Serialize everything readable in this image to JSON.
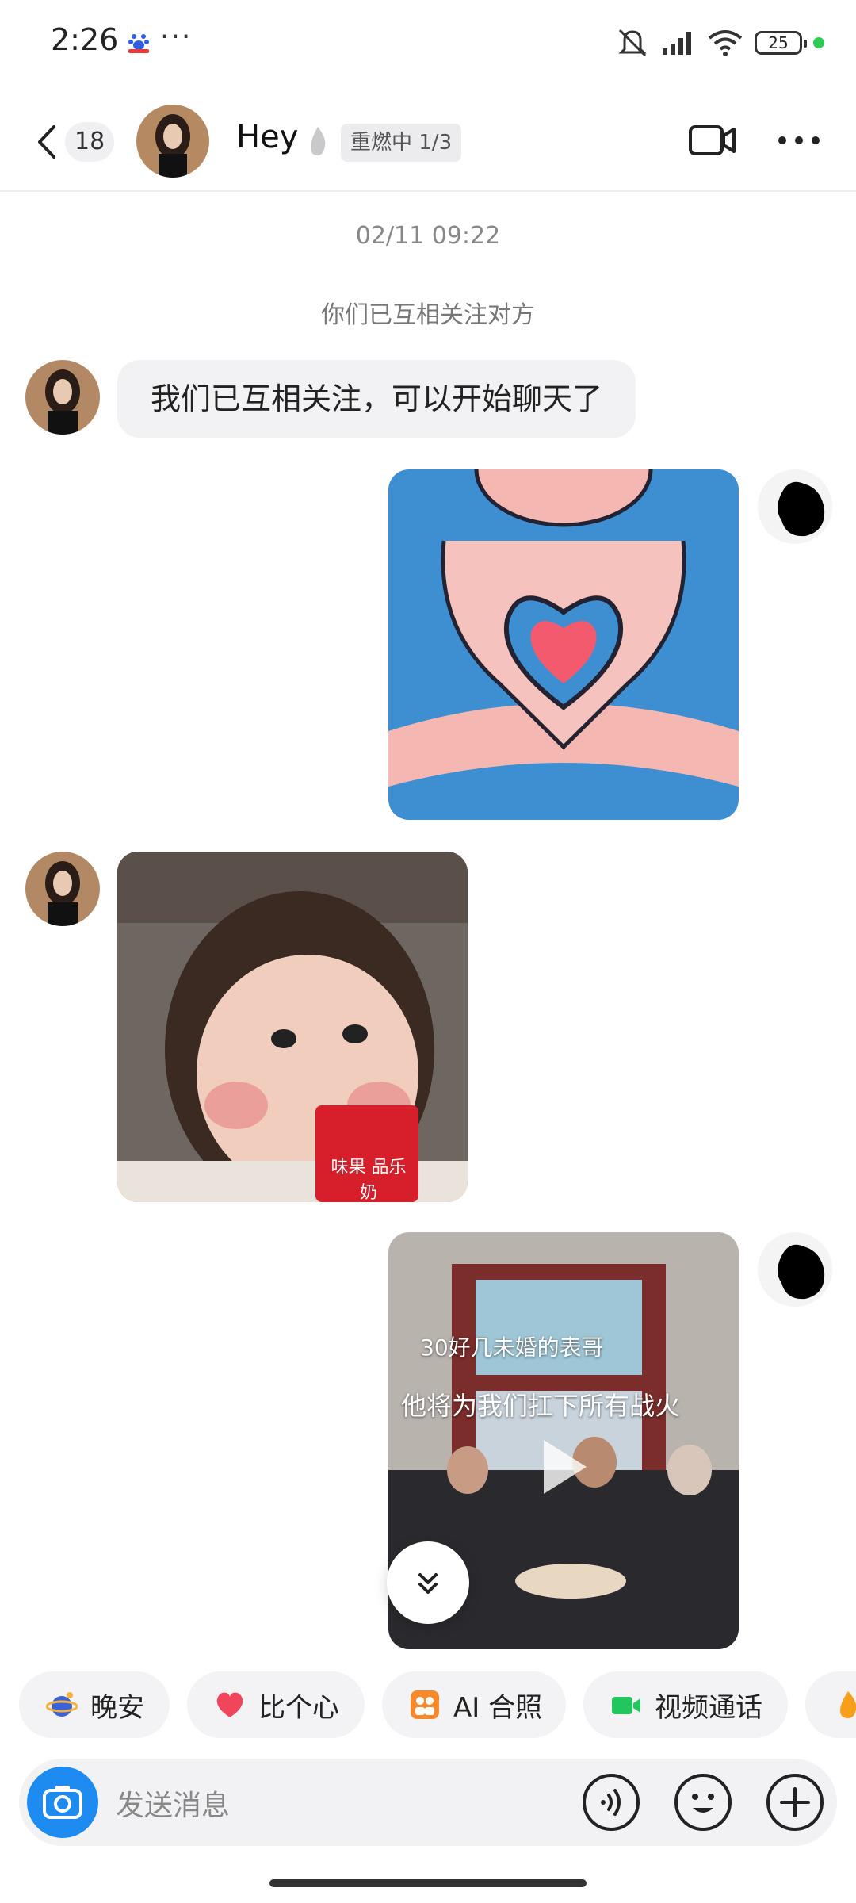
{
  "status_bar": {
    "time": "2:26",
    "more": "···",
    "battery": "25",
    "icons": [
      "baidu-app-icon",
      "mute-icon",
      "signal-icon",
      "wifi-icon",
      "battery-icon"
    ]
  },
  "header": {
    "unread_count": "18",
    "name": "Hey",
    "streak_badge": "重燃中 1/3",
    "icons": [
      "back-chevron-icon",
      "flame-icon",
      "video-call-icon",
      "more-dots-icon"
    ]
  },
  "chat": {
    "timestamp": "02/11 09:22",
    "system_message": "你们已互相关注对方",
    "text_message": "我们已互相关注，可以开始聊天了",
    "video_caption_1": "30好几未婚的表哥",
    "video_caption_2": "他将为我们扛下所有战火",
    "drink_label": "味果 品乐奶"
  },
  "quick_replies": [
    {
      "label": "晚安",
      "icon": "moon-planet-icon"
    },
    {
      "label": "比个心",
      "icon": "heart-icon"
    },
    {
      "label": "AI 合照",
      "icon": "ai-photo-icon"
    },
    {
      "label": "视频通话",
      "icon": "video-icon"
    }
  ],
  "input": {
    "placeholder": "发送消息",
    "icons": [
      "camera-icon",
      "voice-icon",
      "emoji-icon",
      "plus-icon"
    ]
  },
  "colors": {
    "accent_blue": "#1e8bf0",
    "bubble_gray": "#f2f2f4",
    "video_green": "#22c55e",
    "heart_red": "#f0455b",
    "ai_orange": "#f58a2c"
  }
}
